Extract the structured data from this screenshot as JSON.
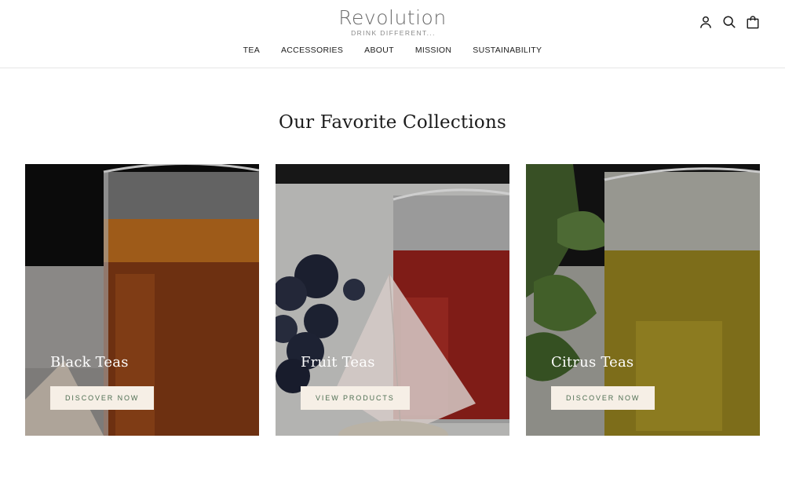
{
  "brand": {
    "title": "Revolution",
    "tagline": "DRINK DIFFERENT..."
  },
  "header_icons": [
    "account-icon",
    "search-icon",
    "cart-icon"
  ],
  "nav": {
    "items": [
      {
        "label": "TEA"
      },
      {
        "label": "ACCESSORIES"
      },
      {
        "label": "ABOUT"
      },
      {
        "label": "MISSION"
      },
      {
        "label": "SUSTAINABILITY"
      }
    ]
  },
  "collections": {
    "title": "Our Favorite Collections",
    "cards": [
      {
        "title": "Black Teas",
        "button": "DISCOVER NOW"
      },
      {
        "title": "Fruit Teas",
        "button": "VIEW PRODUCTS"
      },
      {
        "title": "Citrus Teas",
        "button": "DISCOVER NOW"
      }
    ]
  },
  "colors": {
    "button_bg": "#f6efe6",
    "button_text": "#4e6e52",
    "logo": "#6b6b6b"
  }
}
